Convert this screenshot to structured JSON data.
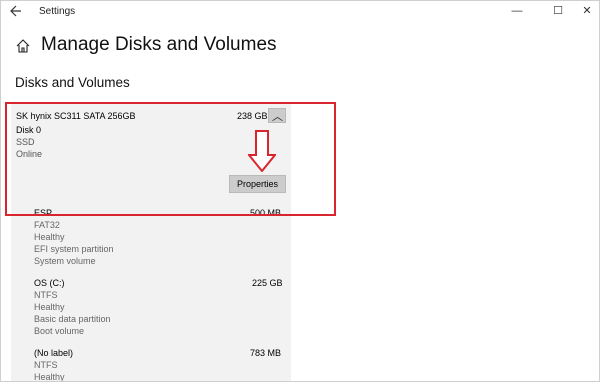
{
  "window": {
    "title": "Settings",
    "back_icon": "back-arrow-icon",
    "controls": {
      "minimize": "—",
      "maximize": "☐",
      "close": "✕"
    }
  },
  "page": {
    "home_icon": "home-icon",
    "title": "Manage Disks and Volumes",
    "section_heading": "Disks and Volumes"
  },
  "disk": {
    "name": "SK hynix SC311 SATA 256GB",
    "size": "238 GB",
    "number": "Disk 0",
    "type": "SSD",
    "status": "Online",
    "properties_label": "Properties",
    "collapse_icon": "chevron-up-icon"
  },
  "volumes": [
    {
      "name": "ESP",
      "size": "500 MB",
      "details": [
        "FAT32",
        "Healthy",
        "EFI system partition",
        "System volume"
      ]
    },
    {
      "name": "OS (C:)",
      "size": "225 GB",
      "details": [
        "NTFS",
        "Healthy",
        "Basic data partition",
        "Boot volume"
      ]
    },
    {
      "name": "(No label)",
      "size": "783 MB",
      "details": [
        "NTFS",
        "Healthy"
      ]
    }
  ],
  "annotation": {
    "highlight_color": "#d9262e",
    "arrow_color": "#d9262e"
  }
}
